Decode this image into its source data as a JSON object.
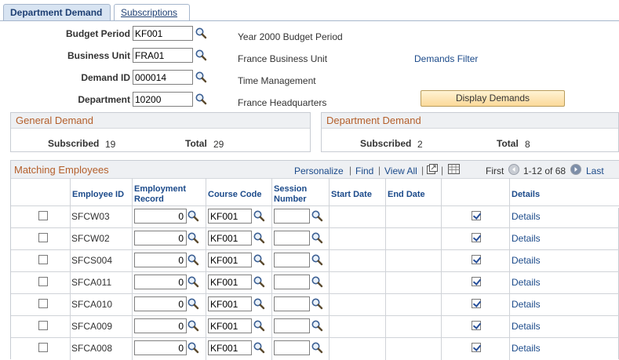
{
  "tabs": [
    {
      "label": "Department Demand",
      "active": true
    },
    {
      "label": "Subscriptions",
      "active": false
    }
  ],
  "form": {
    "budget_period": {
      "label": "Budget Period",
      "value": "KF001",
      "desc": "Year 2000 Budget Period"
    },
    "business_unit": {
      "label": "Business Unit",
      "value": "FRA01",
      "desc": "France Business Unit"
    },
    "demand_id": {
      "label": "Demand ID",
      "value": "000014",
      "desc": "Time Management"
    },
    "department": {
      "label": "Department",
      "value": "10200",
      "desc": "France Headquarters"
    },
    "demands_filter_link": "Demands Filter",
    "display_demands_button": "Display Demands"
  },
  "general_demand": {
    "title": "General Demand",
    "subscribed_label": "Subscribed",
    "subscribed_value": "19",
    "total_label": "Total",
    "total_value": "29"
  },
  "department_demand": {
    "title": "Department Demand",
    "subscribed_label": "Subscribed",
    "subscribed_value": "2",
    "total_label": "Total",
    "total_value": "8"
  },
  "grid": {
    "title": "Matching Employees",
    "personalize": "Personalize",
    "find": "Find",
    "view_all": "View All",
    "first": "First",
    "range": "1-12 of 68",
    "last": "Last",
    "columns": {
      "employee_id": "Employee ID",
      "employment_record_1": "Employment",
      "employment_record_2": "Record",
      "course_code": "Course Code",
      "session_number_1": "Session",
      "session_number_2": "Number",
      "start_date": "Start Date",
      "end_date": "End Date",
      "details": "Details"
    },
    "rows": [
      {
        "employee_id": "SFCW03",
        "empl_rcd": "0",
        "course": "KF001",
        "session": "",
        "details": "Details"
      },
      {
        "employee_id": "SFCW02",
        "empl_rcd": "0",
        "course": "KF001",
        "session": "",
        "details": "Details"
      },
      {
        "employee_id": "SFCS004",
        "empl_rcd": "0",
        "course": "KF001",
        "session": "",
        "details": "Details"
      },
      {
        "employee_id": "SFCA011",
        "empl_rcd": "0",
        "course": "KF001",
        "session": "",
        "details": "Details"
      },
      {
        "employee_id": "SFCA010",
        "empl_rcd": "0",
        "course": "KF001",
        "session": "",
        "details": "Details"
      },
      {
        "employee_id": "SFCA009",
        "empl_rcd": "0",
        "course": "KF001",
        "session": "",
        "details": "Details"
      },
      {
        "employee_id": "SFCA008",
        "empl_rcd": "0",
        "course": "KF001",
        "session": "",
        "details": "Details"
      }
    ]
  },
  "colors": {
    "section_title": "#b45f2b",
    "link": "#1b4a8a",
    "button_bg": "#fbd999"
  }
}
